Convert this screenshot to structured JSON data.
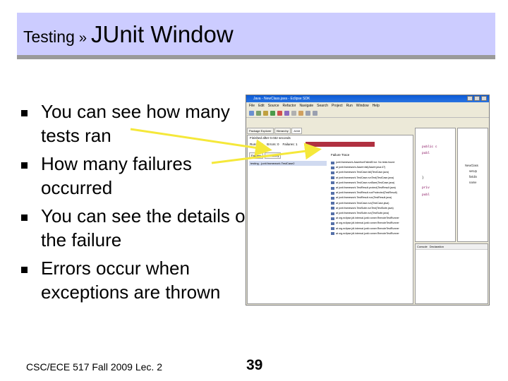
{
  "title": {
    "crumb": "Testing",
    "separator": "»",
    "main": "JUnit Window"
  },
  "bullets": [
    "You can see how many tests ran",
    "How many failures occurred",
    "You can see the details of the failure",
    "Errors occur when exceptions are thrown"
  ],
  "footer": {
    "course": "CSC/ECE 517 Fall 2009   Lec. 2",
    "page_number": "39"
  },
  "screenshot": {
    "window_title": "Java - NewClass.java - Eclipse SDK",
    "menu": [
      "File",
      "Edit",
      "Source",
      "Refactor",
      "Navigate",
      "Search",
      "Project",
      "Run",
      "Window",
      "Help"
    ],
    "view_tabs": [
      "Package Explorer",
      "Hierarchy",
      "JUnit"
    ],
    "status": "Finished after 0.032 seconds",
    "runs": "Runs: 1/1",
    "errors": "Errors: 0",
    "failures": "Failures: 1",
    "fail_color": "#b03040",
    "sub_tabs": [
      "Failures",
      "Hierarchy"
    ],
    "failure_trace_label": "Failure Trace",
    "failure_item": "testing - junit.framework.TestCase2",
    "trace_lines": [
      "junit.framework.AssertionFailedError: No tests found",
      "at junit.framework.Assert.fail(Assert.java:47)",
      "at junit.framework.TestCase.fail(TestCase.java)",
      "at junit.framework.TestCase.runTest(TestCase.java)",
      "at junit.framework.TestCase.runBare(TestCase.java)",
      "at junit.framework.TestResult.protect(TestResult.java)",
      "at junit.framework.TestResult.runProtected(TestResult)",
      "at junit.framework.TestResult.run(TestResult.java)",
      "at junit.framework.TestCase.run(TestCase.java)",
      "at junit.framework.TestSuite.runTest(TestSuite.java)",
      "at junit.framework.TestSuite.run(TestSuite.java)",
      "at org.eclipse.jdt.internal.junit.runner.RemoteTestRunner",
      "at org.eclipse.jdt.internal.junit.runner.RemoteTestRunner",
      "at org.eclipse.jdt.internal.junit.runner.RemoteTestRunner",
      "at org.eclipse.jdt.internal.junit.runner.RemoteTestRunner"
    ],
    "editor_lines": [
      "public c",
      "publ",
      "}",
      "priv",
      "publ"
    ],
    "outline_items": [
      "NewClass",
      "setUp",
      "fieldin",
      "name"
    ],
    "console_tabs": [
      "Console",
      "Declaration"
    ]
  }
}
